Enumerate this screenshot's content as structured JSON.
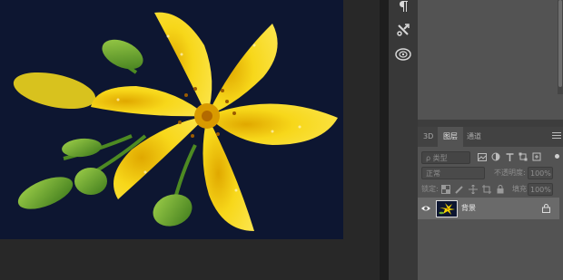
{
  "colors": {
    "canvas_bg": "#282828",
    "image_bg": "#0d1631",
    "panel_bg": "#535353",
    "layer_selected": "#6a6a6a",
    "flower_yellow": "#f4d400",
    "bud_green": "#6fae2e"
  },
  "tool_strip": {
    "items": [
      {
        "icon": "paragraph-icon"
      },
      {
        "icon": "tools-icon"
      },
      {
        "icon": "3d-material-icon"
      }
    ]
  },
  "layers_panel": {
    "tabs": [
      {
        "label": "3D",
        "active": false
      },
      {
        "label": "图层",
        "active": true
      },
      {
        "label": "通道",
        "active": false
      }
    ],
    "filter": {
      "kind_label": "ρ 类型"
    },
    "blend": {
      "mode": "正常",
      "opacity_label": "不透明度:",
      "opacity_value": "100%"
    },
    "lock": {
      "label": "锁定:",
      "fill_label": "填充:",
      "fill_value": "100%"
    },
    "layers": [
      {
        "name": "背景",
        "visible": true,
        "locked": true
      }
    ]
  }
}
